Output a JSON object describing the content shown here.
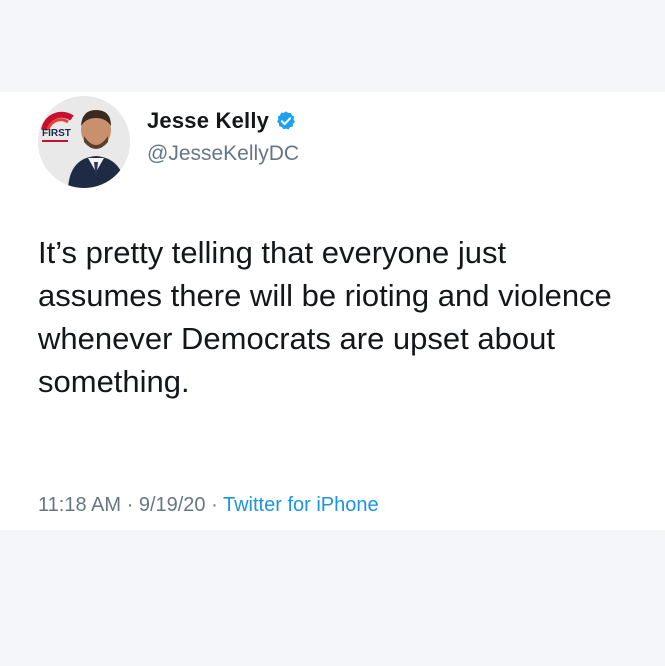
{
  "tweet": {
    "author": {
      "display_name": "Jesse Kelly",
      "handle": "@JesseKellyDC",
      "verified": true,
      "avatar_badge_text": "FIRST"
    },
    "text": "It’s pretty telling that everyone just assumes there will be rioting and violence whenever Democrats are upset about something.",
    "time": "11:18 AM",
    "separator": "·",
    "date": "9/19/20",
    "source": "Twitter for iPhone"
  },
  "colors": {
    "background": "#f5f6fa",
    "card": "#ffffff",
    "text": "#14171a",
    "muted": "#657786",
    "link": "#1b95e0",
    "verified_badge": "#1da1f2"
  },
  "icons": {
    "verified": "verified-badge-icon",
    "avatar": "profile-avatar"
  }
}
